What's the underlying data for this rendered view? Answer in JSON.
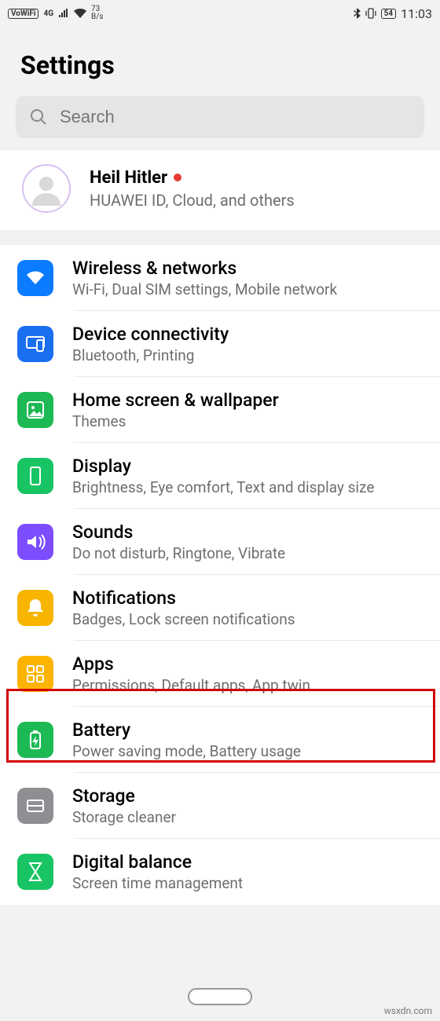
{
  "status": {
    "vowifi": "VoWiFi",
    "net": "4G",
    "speed_top": "73",
    "speed_unit": "B/s",
    "battery": "54",
    "time": "11:03"
  },
  "header": {
    "title": "Settings"
  },
  "search": {
    "placeholder": "Search"
  },
  "account": {
    "name": "Heil Hitler",
    "sub": "HUAWEI ID, Cloud, and others"
  },
  "items": [
    {
      "icon": "wifi-icon",
      "color": "c-blue",
      "title": "Wireless & networks",
      "sub": "Wi-Fi, Dual SIM settings, Mobile network"
    },
    {
      "icon": "device-connectivity-icon",
      "color": "c-blue2",
      "title": "Device connectivity",
      "sub": "Bluetooth, Printing"
    },
    {
      "icon": "wallpaper-icon",
      "color": "c-green",
      "title": "Home screen & wallpaper",
      "sub": "Themes"
    },
    {
      "icon": "display-icon",
      "color": "c-green2",
      "title": "Display",
      "sub": "Brightness, Eye comfort, Text and display size"
    },
    {
      "icon": "sounds-icon",
      "color": "c-purple",
      "title": "Sounds",
      "sub": "Do not disturb, Ringtone, Vibrate"
    },
    {
      "icon": "notifications-icon",
      "color": "c-amber",
      "title": "Notifications",
      "sub": "Badges, Lock screen notifications"
    },
    {
      "icon": "apps-icon",
      "color": "c-amber2",
      "title": "Apps",
      "sub": "Permissions, Default apps, App twin"
    },
    {
      "icon": "battery-icon",
      "color": "c-green",
      "title": "Battery",
      "sub": "Power saving mode, Battery usage"
    },
    {
      "icon": "storage-icon",
      "color": "c-grey",
      "title": "Storage",
      "sub": "Storage cleaner"
    },
    {
      "icon": "digital-balance-icon",
      "color": "c-green2",
      "title": "Digital balance",
      "sub": "Screen time management"
    }
  ],
  "watermark": "wsxdn.com"
}
